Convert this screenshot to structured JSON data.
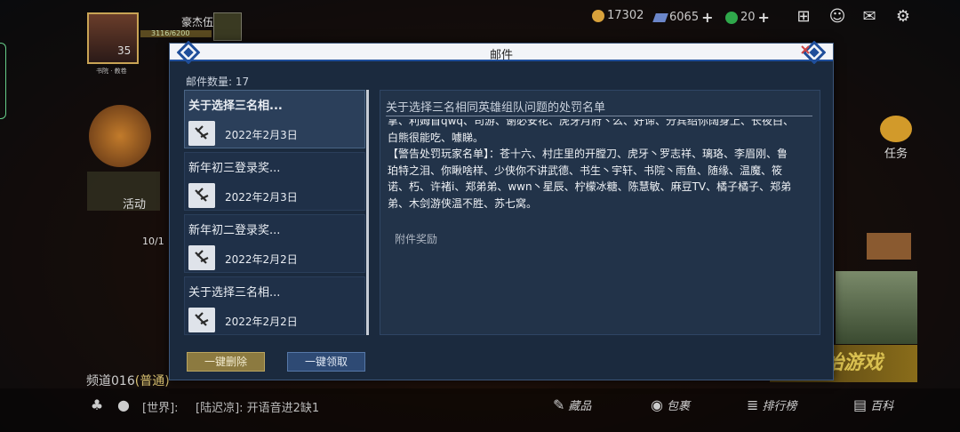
{
  "hud": {
    "player_name": "豪杰伍",
    "level": "35",
    "exp_text": "3116/6200",
    "avatar_sub": "书院 · 教卷",
    "coins": "17302",
    "gems": "6065",
    "jade": "20",
    "activity_label": "活动",
    "level_progress": "10/1",
    "task_label": "任务",
    "start_label": "开始游戏",
    "channel_prefix": "频道016",
    "channel_suffix": "(普通)",
    "world_channel": "[世界]:",
    "world_message": "[陆迟凉]: 开语音进2缺1",
    "nav": [
      {
        "icon": "collection-icon",
        "label": "藏品"
      },
      {
        "icon": "bag-icon",
        "label": "包裹"
      },
      {
        "icon": "ranking-icon",
        "label": "排行榜"
      },
      {
        "icon": "encyclopedia-icon",
        "label": "百科"
      }
    ]
  },
  "mail": {
    "title": "邮件",
    "count_label": "邮件数量: 17",
    "items": [
      {
        "title": "关于选择三名相...",
        "date": "2022年2月3日",
        "active": true
      },
      {
        "title": "新年初三登录奖...",
        "date": "2022年2月3日",
        "active": false
      },
      {
        "title": "新年初二登录奖...",
        "date": "2022年2月2日",
        "active": false
      },
      {
        "title": "关于选择三名相...",
        "date": "2022年2月2日",
        "active": false
      }
    ],
    "content_title": "关于选择三名相同英雄组队问题的处罚名单",
    "content_body": "拿、利姆首qwq、司游、谢必安花、虎牙月府丶么、好谛、分宾绍你阔身上、长夜白、\n白熊很能吃、噱睇。\n【警告处罚玩家名单】：苍十六、村庄里的开膛刀、虎牙丶罗志祥、璃珞、李眉刚、鲁\n珀特之泪、你瞅啥样、少侠你不讲武德、书生丶宇轩、书院丶雨鱼、随缘、温魔、筱\n诺、朽、许褚i、郑弟弟、wwn丶星辰、柠檬冰糖、陈慧敏、麻豆TV、橘子橘子、郑弟\n弟、木剑游侠温不胜、苏七窝。\n\n感谢各位少侠的支持，我们将继续努力为各位少侠提供更好的游戏环境。",
    "attachment_label": "附件奖励",
    "delete_all_label": "一键删除",
    "claim_all_label": "一键领取"
  },
  "colors": {
    "modal_bg": "#1b2a3e",
    "header_bg": "#f2f4f8",
    "delete_btn": "#8c7a40",
    "claim_btn": "#2e4a74"
  }
}
